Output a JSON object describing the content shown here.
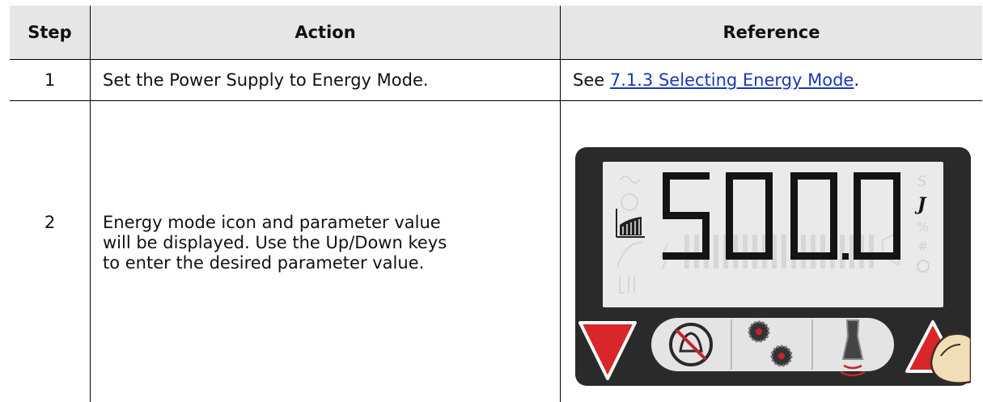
{
  "table": {
    "headers": {
      "step": "Step",
      "action": "Action",
      "reference": "Reference"
    },
    "rows": [
      {
        "step": "1",
        "action": "Set the Power Supply to Energy Mode.",
        "reference_prefix": "See ",
        "reference_link": "7.1.3 Selecting Energy Mode",
        "reference_suffix": "."
      },
      {
        "step": "2",
        "action_lines": [
          "Energy mode icon and parameter value",
          "will be displayed. Use the Up/Down keys",
          "to enter the desired parameter value."
        ]
      }
    ]
  },
  "display": {
    "value": "500.0",
    "unit": "J",
    "faint_units": [
      "S",
      "%",
      "#"
    ],
    "mode_icon": "energy-mode-icon",
    "buttons": [
      "down-arrow-button",
      "alarm-off-button",
      "gears-button",
      "horn-button",
      "up-arrow-button"
    ],
    "colors": {
      "panel": "#2a2a2a",
      "lcd": "#e9ebe9",
      "arrow": "#d8262a",
      "accent_dot": "#c8232a"
    }
  }
}
